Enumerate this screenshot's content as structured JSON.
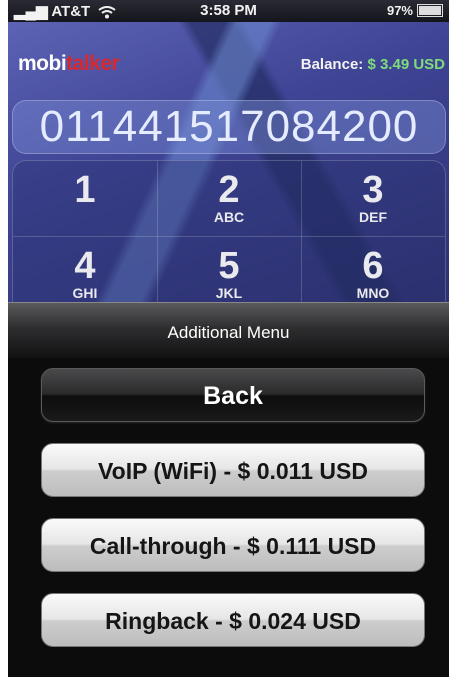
{
  "status_bar": {
    "carrier": "AT&T",
    "time": "3:58 PM",
    "battery": "97%"
  },
  "app": {
    "logo_prefix": "mobi",
    "logo_suffix": "talker",
    "balance_label": "Balance:",
    "balance_value": "$ 3.49 USD",
    "dialed_number": "011441517084200"
  },
  "keypad": [
    {
      "digit": "1",
      "letters": ""
    },
    {
      "digit": "2",
      "letters": "ABC"
    },
    {
      "digit": "3",
      "letters": "DEF"
    },
    {
      "digit": "4",
      "letters": "GHI"
    },
    {
      "digit": "5",
      "letters": "JKL"
    },
    {
      "digit": "6",
      "letters": "MNO"
    }
  ],
  "menu": {
    "title": "Additional Menu",
    "back_label": "Back",
    "voip_label": "VoIP (WiFi) - $ 0.011 USD",
    "callthrough_label": "Call-through - $ 0.111 USD",
    "ringback_label": "Ringback - $ 0.024 USD"
  },
  "colors": {
    "balance_green": "#7fdd7a",
    "logo_red": "#d8282d"
  }
}
